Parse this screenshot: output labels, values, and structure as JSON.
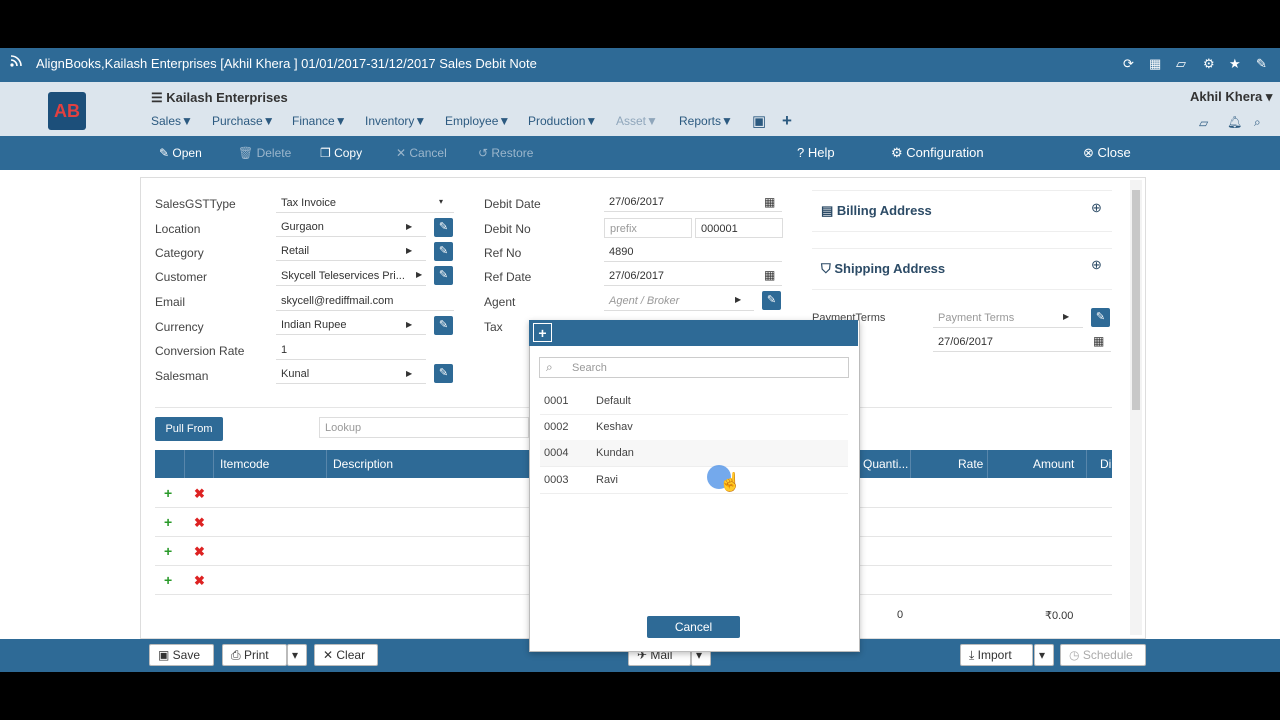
{
  "window": {
    "title": "AlignBooks,Kailash Enterprises [Akhil Khera ] 01/01/2017-31/12/2017 Sales Debit Note"
  },
  "header": {
    "company": "Kailash Enterprises",
    "user": "Akhil Khera",
    "logo_text": "AB",
    "menu": [
      "Sales▼",
      "Purchase▼",
      "Finance▼",
      "Inventory▼",
      "Employee▼",
      "Production▼",
      "Asset▼",
      "Reports▼"
    ]
  },
  "toolbar": {
    "open": "Open",
    "delete": "Delete",
    "copy": "Copy",
    "cancel": "Cancel",
    "restore": "Restore",
    "help": "Help",
    "configuration": "Configuration",
    "close": "Close"
  },
  "form": {
    "sales_gst_type": {
      "label": "SalesGSTType",
      "value": "Tax Invoice"
    },
    "location": {
      "label": "Location",
      "value": "Gurgaon"
    },
    "category": {
      "label": "Category",
      "value": "Retail"
    },
    "customer": {
      "label": "Customer",
      "value": "Skycell Teleservices Pri..."
    },
    "email": {
      "label": "Email",
      "value": "skycell@rediffmail.com"
    },
    "currency": {
      "label": "Currency",
      "value": "Indian Rupee"
    },
    "conversion_rate": {
      "label": "Conversion Rate",
      "value": "1"
    },
    "salesman": {
      "label": "Salesman",
      "value": "Kunal"
    },
    "debit_date": {
      "label": "Debit Date",
      "value": "27/06/2017"
    },
    "debit_no": {
      "label": "Debit No",
      "prefix_placeholder": "prefix",
      "value": "000001"
    },
    "ref_no": {
      "label": "Ref No",
      "value": "4890"
    },
    "ref_date": {
      "label": "Ref Date",
      "value": "27/06/2017"
    },
    "agent": {
      "label": "Agent",
      "placeholder": "Agent / Broker"
    },
    "tax": {
      "label": "Tax"
    },
    "billing_address": "Billing Address",
    "shipping_address": "Shipping Address",
    "payment_terms": {
      "label": "PaymentTerms",
      "placeholder": "Payment Terms",
      "date": "27/06/2017"
    }
  },
  "grid": {
    "pull_from": "Pull From",
    "lookup_placeholder": "Lookup",
    "columns": {
      "itemcode": "Itemcode",
      "description": "Description",
      "quantity": "Quanti...",
      "rate": "Rate",
      "amount": "Amount",
      "di": "Di"
    },
    "totals": {
      "quantity": "0",
      "amount": "₹0.00"
    }
  },
  "modal": {
    "search_placeholder": "Search",
    "options": [
      {
        "code": "0001",
        "name": "Default"
      },
      {
        "code": "0002",
        "name": "Keshav"
      },
      {
        "code": "0004",
        "name": "Kundan"
      },
      {
        "code": "0003",
        "name": "Ravi"
      }
    ],
    "cancel": "Cancel"
  },
  "footer": {
    "save": "Save",
    "print": "Print",
    "clear": "Clear",
    "mail": "Mail",
    "import": "Import",
    "schedule": "Schedule"
  }
}
